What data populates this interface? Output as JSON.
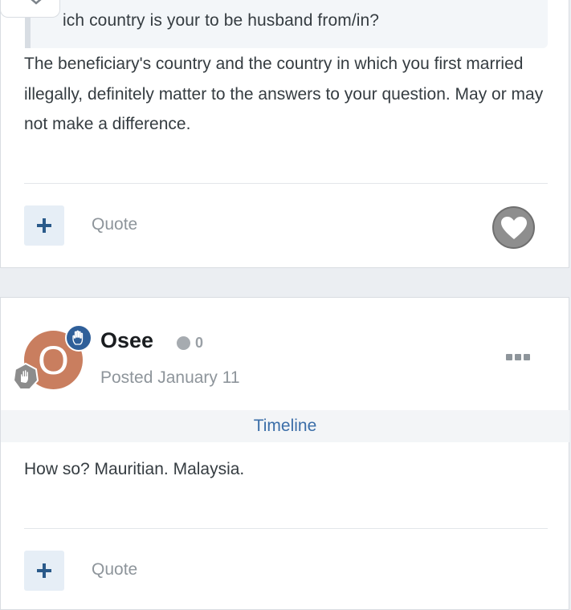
{
  "post1": {
    "quote_text": "ich country is your to be husband from/in?",
    "body": "The beneficiary's country and the country in which you first married illegally, definitely matter to the answers to your question.  May or may not make a difference.",
    "add_label": "+",
    "quote_label": "Quote"
  },
  "post2": {
    "author": "Osee",
    "avatar_letter": "O",
    "reputation": "0",
    "posted": "Posted January 11",
    "timeline_label": "Timeline",
    "body": "How so? Mauritian. Malaysia.",
    "add_label": "+",
    "quote_label": "Quote"
  },
  "colors": {
    "accent": "#2f5f99",
    "link": "#3b6ea8",
    "avatar": "#c97e5f"
  }
}
